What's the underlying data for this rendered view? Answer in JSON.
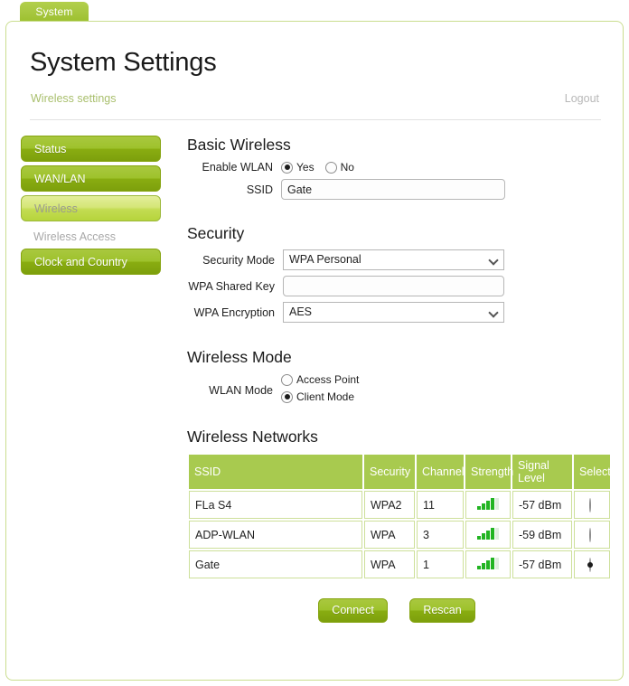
{
  "tab": {
    "label": "System"
  },
  "header": {
    "title": "System Settings",
    "subtitle": "Wireless settings",
    "logout": "Logout"
  },
  "sidebar": {
    "items": [
      {
        "label": "Status",
        "state": "normal"
      },
      {
        "label": "WAN/LAN",
        "state": "normal"
      },
      {
        "label": "Wireless",
        "state": "active"
      },
      {
        "label": "Wireless Access",
        "state": "sub"
      },
      {
        "label": "Clock and Country",
        "state": "normal"
      }
    ]
  },
  "basic_wireless": {
    "title": "Basic Wireless",
    "enable_wlan_label": "Enable WLAN",
    "enable_yes_label": "Yes",
    "enable_no_label": "No",
    "enable_selected": "Yes",
    "ssid_label": "SSID",
    "ssid_value": "Gate",
    "ssid_placeholder": ""
  },
  "security": {
    "title": "Security",
    "mode_label": "Security Mode",
    "mode_value": "WPA Personal",
    "key_label": "WPA Shared Key",
    "key_value": "",
    "key_placeholder": "",
    "encryption_label": "WPA Encryption",
    "encryption_value": "AES"
  },
  "wireless_mode": {
    "title": "Wireless Mode",
    "wlan_mode_label": "WLAN Mode",
    "access_point_label": "Access Point",
    "client_mode_label": "Client Mode",
    "selected": "Client Mode"
  },
  "networks": {
    "title": "Wireless Networks",
    "columns": [
      "SSID",
      "Security",
      "Channel",
      "Strength",
      "Signal Level",
      "Select"
    ],
    "rows": [
      {
        "ssid": "FLa S4",
        "security": "WPA2",
        "channel": "11",
        "strength": 4,
        "level": "-57 dBm",
        "selected": false
      },
      {
        "ssid": "ADP-WLAN",
        "security": "WPA",
        "channel": "3",
        "strength": 4,
        "level": "-59 dBm",
        "selected": false
      },
      {
        "ssid": "Gate",
        "security": "WPA",
        "channel": "1",
        "strength": 4,
        "level": "-57 dBm",
        "selected": true
      }
    ]
  },
  "actions": {
    "connect_label": "Connect",
    "rescan_label": "Rescan"
  },
  "colors": {
    "brand_green": "#9ec22c",
    "header_green": "#a8ca4f",
    "border_green": "#cadd8f",
    "signal_green": "#22b422"
  }
}
